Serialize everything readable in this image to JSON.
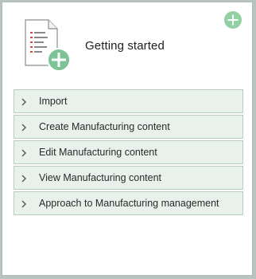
{
  "card": {
    "title": "Getting started",
    "title_icon": "document-add-icon",
    "corner_action_icon": "plus-circle-icon"
  },
  "sections": [
    {
      "label": "Import",
      "icon": "chevron-right-icon"
    },
    {
      "label": "Create Manufacturing content",
      "icon": "chevron-right-icon"
    },
    {
      "label": "Edit Manufacturing content",
      "icon": "chevron-right-icon"
    },
    {
      "label": "View Manufacturing content",
      "icon": "chevron-right-icon"
    },
    {
      "label": "Approach to Manufacturing management",
      "icon": "chevron-right-icon"
    }
  ],
  "colors": {
    "page_background": "#b7c4bf",
    "card_background": "#ffffff",
    "section_background": "#e8f1eb",
    "section_border": "#b9cdbf",
    "accent_green": "#93d0a4",
    "accent_green_dark": "#6bbf85"
  }
}
